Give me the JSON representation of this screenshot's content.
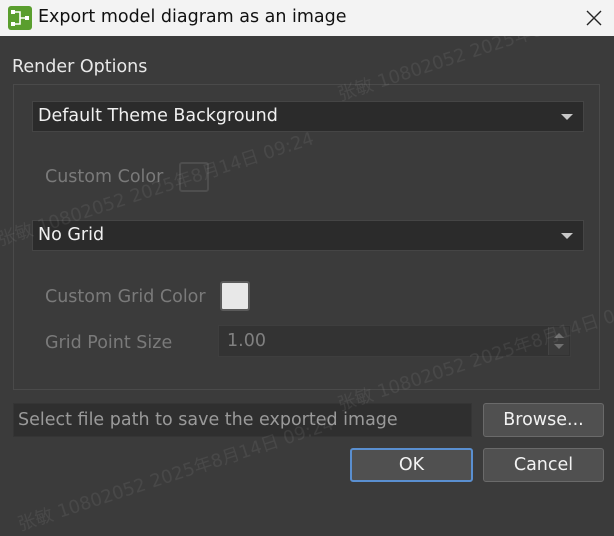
{
  "window": {
    "title": "Export model diagram as an image",
    "app_icon": "model-diagram-app-icon",
    "close_icon": "close-icon"
  },
  "render_options": {
    "section_title": "Render Options",
    "background_mode": {
      "selected": "Default Theme Background"
    },
    "custom_color": {
      "label": "Custom Color",
      "swatch_color": "#3c3c3c",
      "enabled": false
    },
    "grid_mode": {
      "selected": "No Grid"
    },
    "custom_grid_color": {
      "label": "Custom Grid Color",
      "swatch_color": "#e8e8e8",
      "enabled": false
    },
    "grid_point_size": {
      "label": "Grid Point Size",
      "value": "1.00",
      "enabled": false
    }
  },
  "file": {
    "path_value": "",
    "path_placeholder": "Select file path to save the exported image",
    "browse_label": "Browse..."
  },
  "actions": {
    "ok_label": "OK",
    "cancel_label": "Cancel"
  },
  "watermark": {
    "text": "张敏 10802052 2025年8月14日 09:24"
  },
  "colors": {
    "accent": "#5a8fd0",
    "dialog_bg": "#3b3b3b",
    "titlebar_bg": "#f3f3f3",
    "app_icon_bg": "#5a9e2e"
  }
}
